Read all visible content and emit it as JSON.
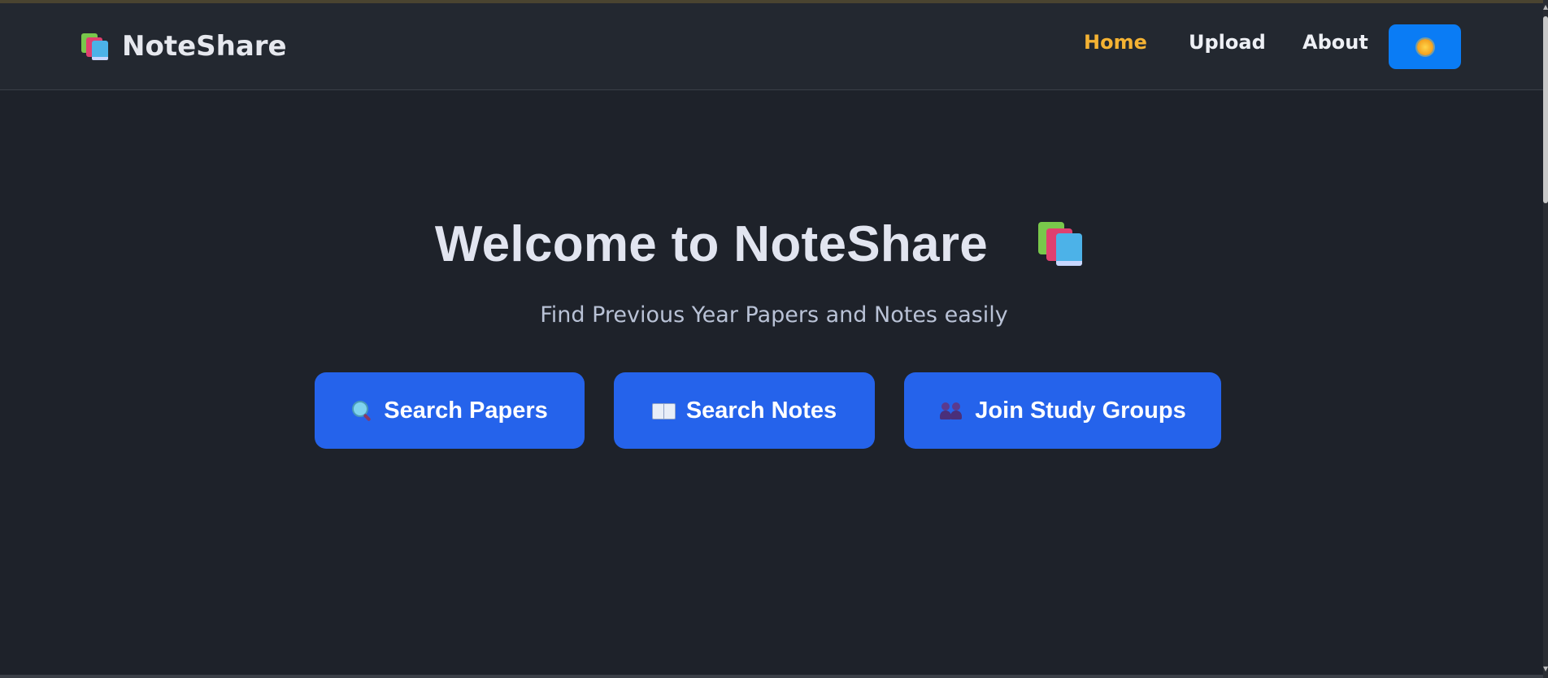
{
  "brand": {
    "name": "NoteShare",
    "icon": "books-icon"
  },
  "nav": {
    "items": [
      {
        "label": "Home",
        "active": true
      },
      {
        "label": "Upload",
        "active": false
      },
      {
        "label": "About",
        "active": false
      }
    ],
    "theme_toggle_icon": "sun-icon"
  },
  "hero": {
    "title": "Welcome to NoteShare",
    "title_icon": "books-icon",
    "subtitle": "Find Previous Year Papers and Notes easily"
  },
  "actions": [
    {
      "label": "Search Papers",
      "icon": "magnifier-icon"
    },
    {
      "label": "Search Notes",
      "icon": "open-book-icon"
    },
    {
      "label": "Join Study Groups",
      "icon": "people-icon"
    }
  ],
  "colors": {
    "background": "#1e222a",
    "navbar": "#232830",
    "accent_active": "#f4b233",
    "primary_button": "#2563eb",
    "theme_button": "#0a7cf5"
  }
}
